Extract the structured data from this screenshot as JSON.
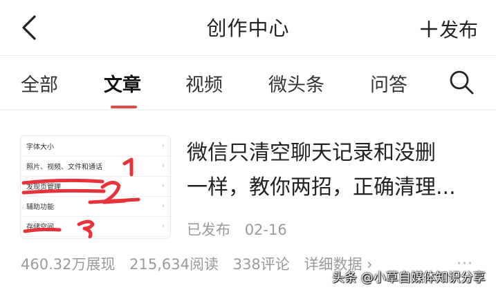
{
  "header": {
    "title": "创作中心",
    "publish_label": "发布"
  },
  "tabs": [
    {
      "label": "全部"
    },
    {
      "label": "文章",
      "active": true
    },
    {
      "label": "视频"
    },
    {
      "label": "微头条"
    },
    {
      "label": "问答"
    }
  ],
  "article": {
    "thumbnail_rows": [
      "字体大小",
      "照片、视频、文件和通话",
      "发现页管理",
      "辅助功能",
      "存储空间"
    ],
    "thumbnail_annotations": [
      "1",
      "2",
      "3"
    ],
    "title_line1": "微信只清空聊天记录和没删",
    "title_line2": "一样，教你两招，正确清理...",
    "status": "已发布",
    "date": "02-16",
    "stats": {
      "views": "460.32万展现",
      "reads": "215,634阅读",
      "comments": "338评论",
      "detail_label": "详细数据 ›"
    },
    "more_label": "···"
  },
  "watermark": "头条 @小草自媒体知识分享",
  "colors": {
    "accent": "#e24a4a",
    "annotation": "#e8323a",
    "muted_text": "#9a9a9a"
  },
  "icons": {
    "back": "chevron-left-icon",
    "plus": "plus-icon",
    "search": "search-icon",
    "row_chevron": "chevron-right-icon"
  }
}
